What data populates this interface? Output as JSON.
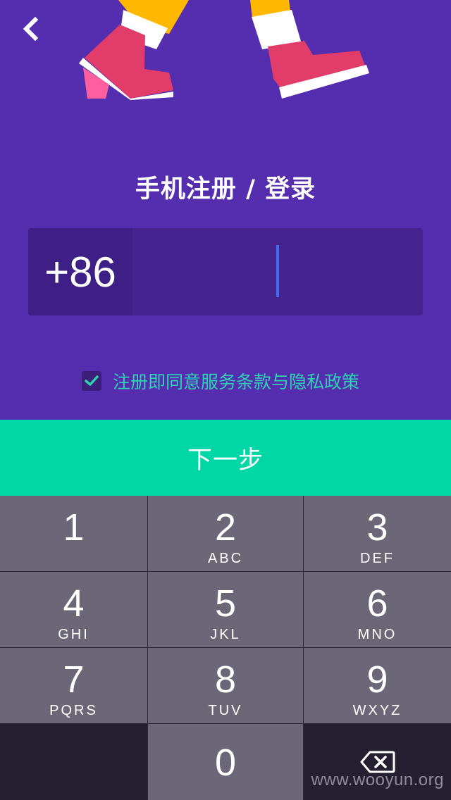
{
  "header": {
    "back_icon": "chevron-left-icon",
    "title": "手机注册 / 登录"
  },
  "phone": {
    "country_code": "+86",
    "value": "",
    "placeholder": ""
  },
  "agreement": {
    "checked": true,
    "text": "注册即同意服务条款与隐私政策"
  },
  "next_button": {
    "label": "下一步"
  },
  "keypad": {
    "keys": [
      {
        "digit": "1",
        "letters": ""
      },
      {
        "digit": "2",
        "letters": "ABC"
      },
      {
        "digit": "3",
        "letters": "DEF"
      },
      {
        "digit": "4",
        "letters": "GHI"
      },
      {
        "digit": "5",
        "letters": "JKL"
      },
      {
        "digit": "6",
        "letters": "MNO"
      },
      {
        "digit": "7",
        "letters": "PQRS"
      },
      {
        "digit": "8",
        "letters": "TUV"
      },
      {
        "digit": "9",
        "letters": "WXYZ"
      },
      {
        "digit": "0",
        "letters": ""
      }
    ],
    "delete_icon": "backspace-icon"
  },
  "watermark": "www.wooyun.org",
  "colors": {
    "background": "#542EAF",
    "accent": "#00D7A6",
    "agreement_text": "#2ED3B4",
    "keypad_key": "#6B6777",
    "caret": "#3F6CF0"
  }
}
